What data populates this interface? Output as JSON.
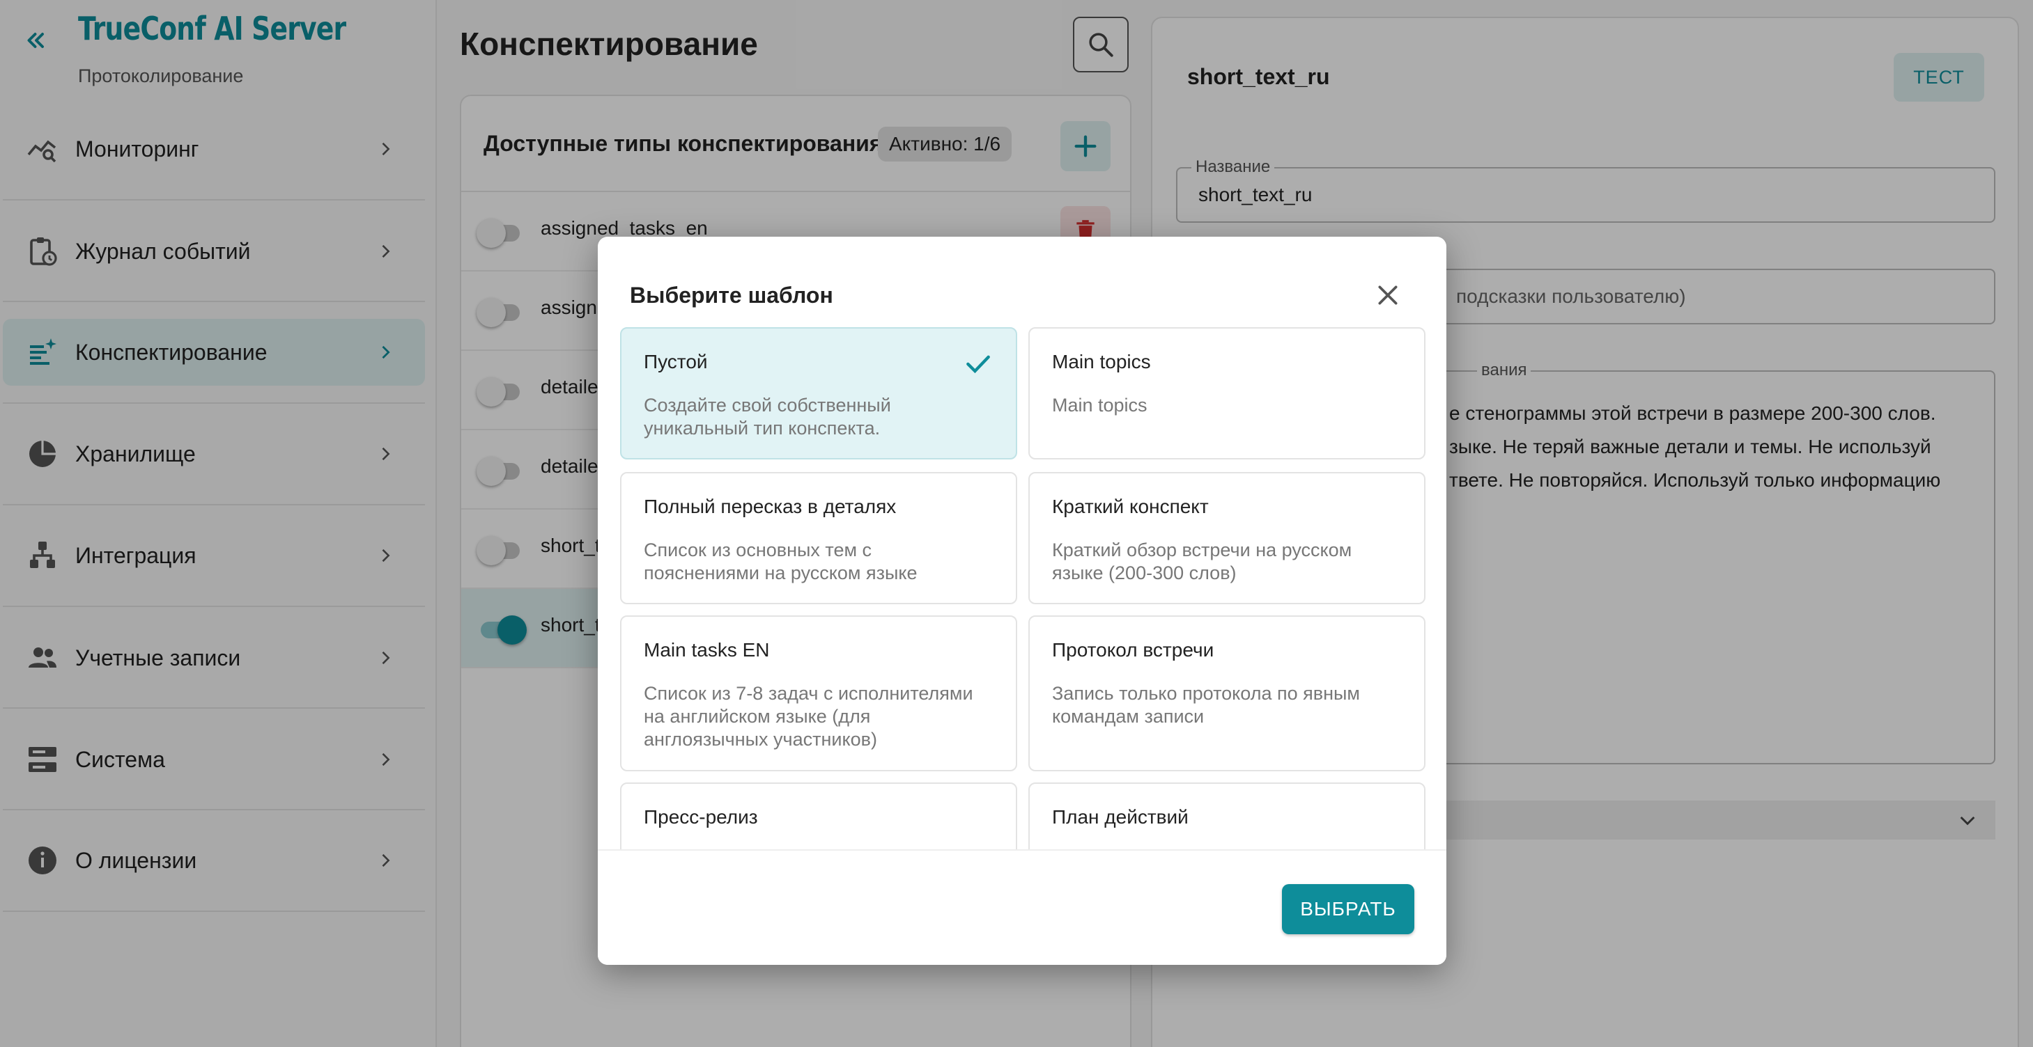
{
  "brand": {
    "title": "TrueConf AI Server",
    "subtitle": "Протоколирование"
  },
  "colors": {
    "accent": "#0e8d9a",
    "accent_light": "#dff0f1",
    "danger": "#d32f2f"
  },
  "sidebar": {
    "items": [
      {
        "label": "Мониторинг",
        "icon": "monitoring-chart-icon"
      },
      {
        "label": "Журнал событий",
        "icon": "clipboard-clock-icon"
      },
      {
        "label": "Конспектирование",
        "icon": "text-sparkle-icon",
        "active": true
      },
      {
        "label": "Хранилище",
        "icon": "pie-chart-icon"
      },
      {
        "label": "Интеграция",
        "icon": "hierarchy-icon"
      },
      {
        "label": "Учетные записи",
        "icon": "people-icon"
      },
      {
        "label": "Система",
        "icon": "server-icon"
      },
      {
        "label": "О лицензии",
        "icon": "info-icon"
      }
    ]
  },
  "main": {
    "title": "Конспектирование",
    "list": {
      "title": "Доступные типы конспектирования",
      "active_chip": "Активно: 1/6",
      "rows": [
        {
          "label": "assigned_tasks_en",
          "enabled": false
        },
        {
          "label": "assign",
          "enabled": false
        },
        {
          "label": "detaile",
          "enabled": false
        },
        {
          "label": "detaile",
          "enabled": false
        },
        {
          "label": "short_t",
          "enabled": false
        },
        {
          "label": "short_t",
          "enabled": true,
          "selected": true
        }
      ]
    }
  },
  "detail": {
    "title": "short_text_ru",
    "test_label": "ТЕСТ",
    "name_field": {
      "legend": "Название",
      "value": "short_text_ru"
    },
    "hint_field": {
      "value": "подсказки пользователю)"
    },
    "prompt_field": {
      "legend": "вания",
      "lines": [
        "е стенограммы этой встречи в размере 200-300 слов.",
        "зыке. Не теряй важные детали и темы. Не используй",
        "твете. Не повторяйся. Используй только информацию"
      ]
    }
  },
  "dialog": {
    "title": "Выберите шаблон",
    "templates": [
      {
        "title": "Пустой",
        "desc": "Создайте свой собственный уникальный тип конспекта.",
        "selected": true
      },
      {
        "title": "Main topics",
        "desc": "Main topics"
      },
      {
        "title": "Полный пересказ в деталях",
        "desc": "Список из основных тем с пояснениями на русском языке"
      },
      {
        "title": "Краткий конспект",
        "desc": "Краткий обзор встречи на русском языке (200-300 слов)"
      },
      {
        "title": "Main tasks EN",
        "desc": "Список из 7-8 задач с исполнителями на английском языке (для англоязычных участников)"
      },
      {
        "title": "Протокол встречи",
        "desc": "Запись только протокола по явным командам записи"
      },
      {
        "title": "Пресс-релиз",
        "desc": ""
      },
      {
        "title": "План действий",
        "desc": ""
      }
    ],
    "select_label": "ВЫБРАТЬ"
  }
}
